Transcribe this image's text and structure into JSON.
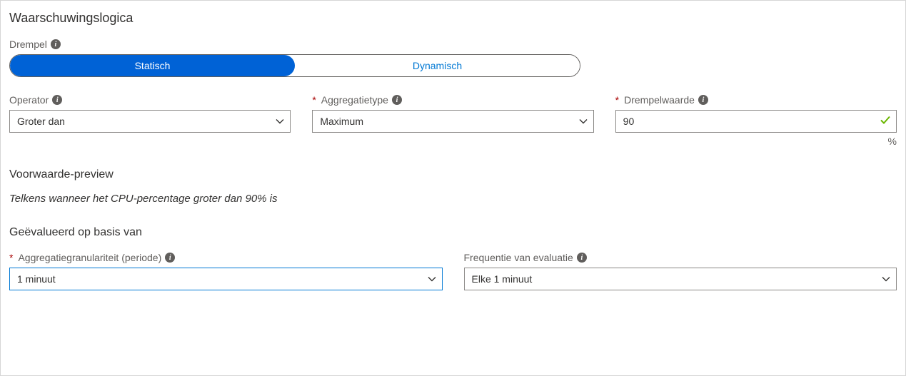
{
  "section_title": "Waarschuwingslogica",
  "threshold": {
    "label": "Drempel",
    "options": {
      "static": "Statisch",
      "dynamic": "Dynamisch"
    }
  },
  "operator": {
    "label": "Operator",
    "value": "Groter dan"
  },
  "aggregation_type": {
    "label": "Aggregatietype",
    "value": "Maximum"
  },
  "threshold_value": {
    "label": "Drempelwaarde",
    "value": "90",
    "unit": "%"
  },
  "preview": {
    "heading": "Voorwaarde-preview",
    "text": "Telkens wanneer het CPU-percentage groter dan 90% is"
  },
  "evaluated": {
    "heading": "Geëvalueerd op basis van"
  },
  "granularity": {
    "label": "Aggregatiegranulariteit (periode)",
    "value": "1 minuut"
  },
  "frequency": {
    "label": "Frequentie van evaluatie",
    "value": "Elke 1 minuut"
  }
}
